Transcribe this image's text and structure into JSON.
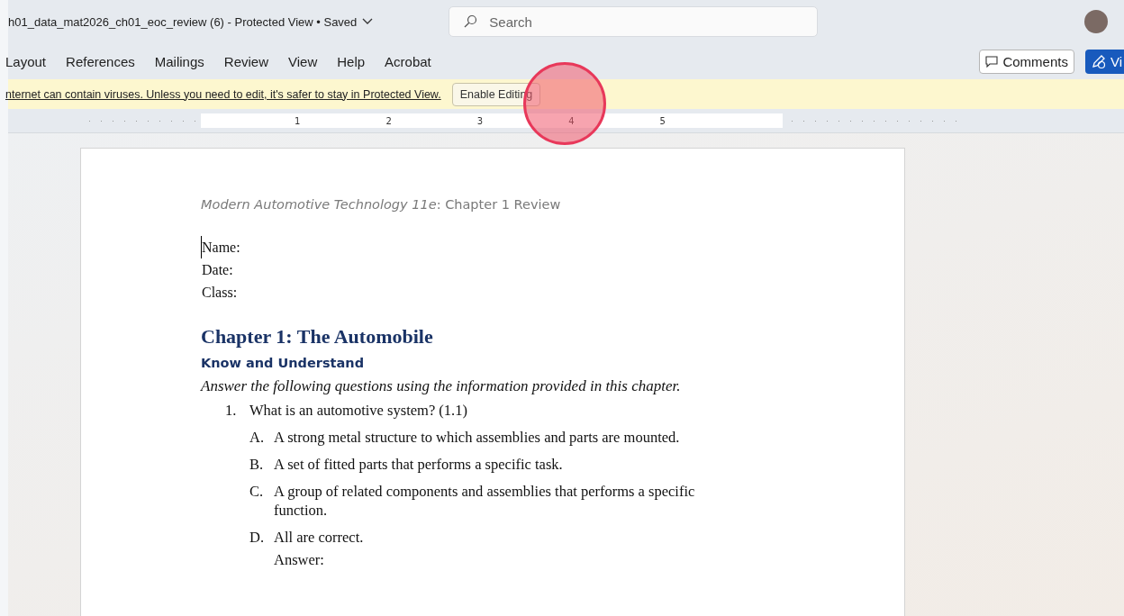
{
  "window": {
    "title": "h01_data_mat2026_ch01_eoc_review (6)  -  Protected View • Saved"
  },
  "search": {
    "placeholder": "Search"
  },
  "ribbon_tabs": [
    {
      "label": "Layout",
      "selected": false
    },
    {
      "label": "References",
      "selected": false
    },
    {
      "label": "Mailings",
      "selected": false
    },
    {
      "label": "Review",
      "selected": false
    },
    {
      "label": "View",
      "selected": false
    },
    {
      "label": "Help",
      "selected": false
    },
    {
      "label": "Acrobat",
      "selected": false
    }
  ],
  "ribbon_buttons": {
    "comments": "Comments",
    "view": "Vi"
  },
  "message_bar": {
    "text": "nternet can contain viruses. Unless you need to edit, it's safer to stay in Protected View.",
    "button": "Enable Editing"
  },
  "ruler": {
    "labels": [
      "1",
      "2",
      "3",
      "4",
      "5"
    ]
  },
  "document": {
    "header": "*Modern Automotive Technology 11e*: Chapter 1 Review",
    "fields": [
      "Name:",
      "Date:",
      "Class:"
    ],
    "heading": "Chapter 1: The Automobile",
    "subheading": "Know and Understand",
    "instructions": "Answer the following questions using the information provided in this chapter.",
    "questions": [
      {
        "number": "1.",
        "text": "What is an automotive system? (1.1)",
        "options": [
          {
            "letter": "A.",
            "text": "A strong metal structure to which assemblies and parts are mounted."
          },
          {
            "letter": "B.",
            "text": "A set of fitted parts that performs a specific task."
          },
          {
            "letter": "C.",
            "text": "A group of related components and assemblies that performs a specific function."
          },
          {
            "letter": "D.",
            "text": "All are correct."
          }
        ],
        "answer_label": "Answer:"
      }
    ]
  }
}
